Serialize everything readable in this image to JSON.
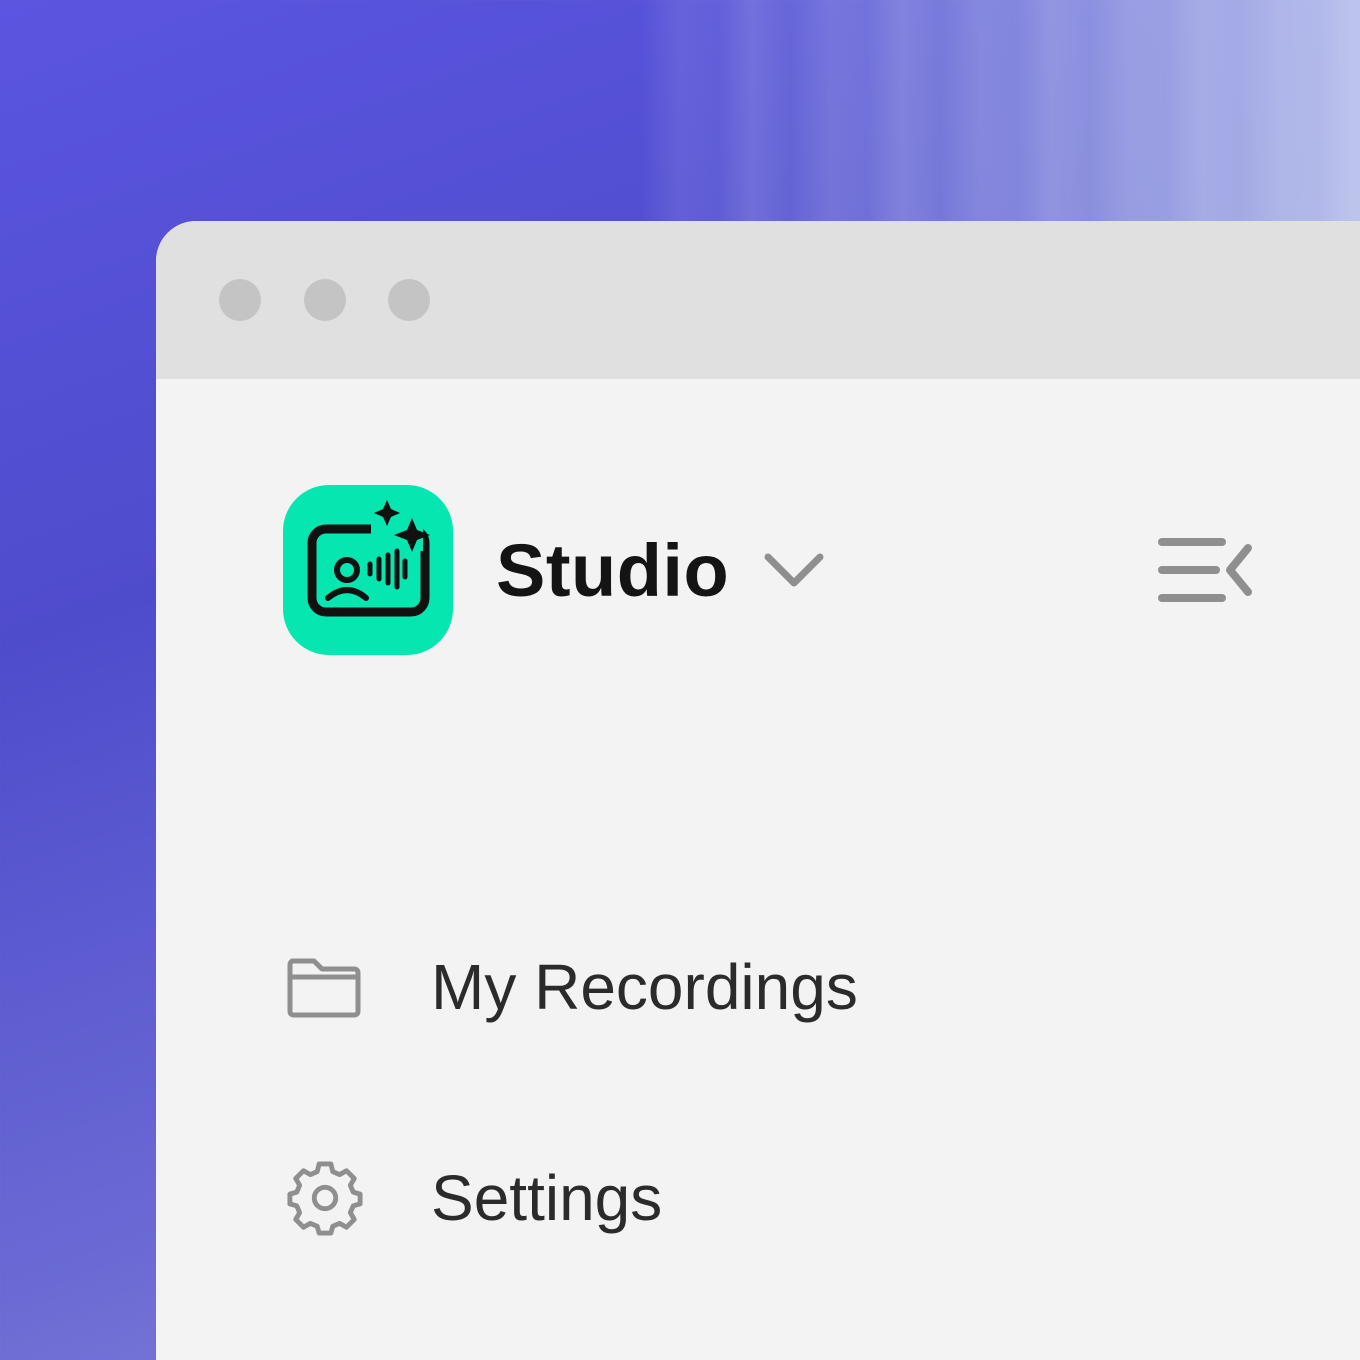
{
  "window": {
    "traffic_lights": [
      "close",
      "minimize",
      "maximize"
    ]
  },
  "header": {
    "logo_icon": "studio-app-icon",
    "workspace_name": "Studio",
    "dropdown_icon": "chevron-down-icon",
    "collapse_icon": "sidebar-collapse-icon"
  },
  "sidebar": {
    "items": [
      {
        "icon": "folder-icon",
        "label": "My Recordings"
      },
      {
        "icon": "gear-icon",
        "label": "Settings"
      }
    ]
  },
  "colors": {
    "brand_accent": "#06e6b1",
    "background_gradient_start": "#5b55e0",
    "window_background": "#f3f3f3",
    "titlebar": "#e0e0e0",
    "icon_gray": "#8f8f8f"
  }
}
